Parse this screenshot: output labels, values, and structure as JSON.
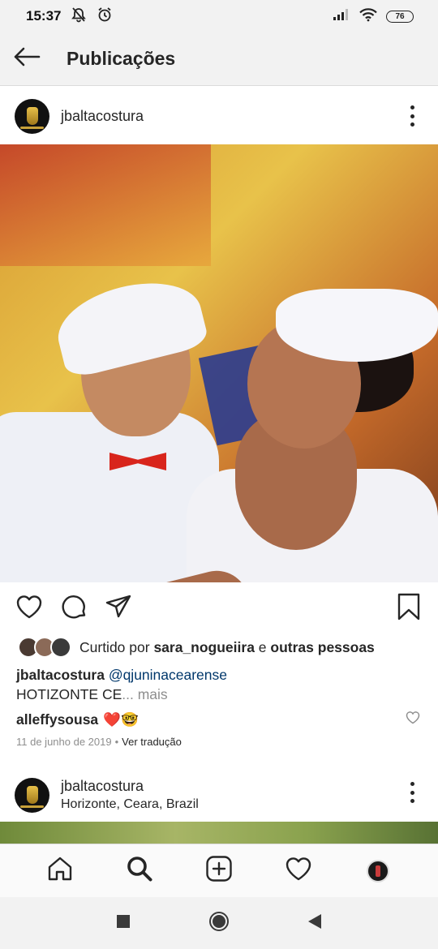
{
  "status_bar": {
    "time": "15:37",
    "battery": "76",
    "icons": [
      "mute-notifications-icon",
      "alarm-icon",
      "signal-icon",
      "wifi-icon",
      "battery-icon"
    ]
  },
  "header": {
    "title": "Publicações",
    "back_icon": "arrow-left-icon"
  },
  "post": {
    "username": "jbaltacostura",
    "actions": [
      "heart-icon",
      "comment-icon",
      "share-icon",
      "bookmark-icon"
    ],
    "likes": {
      "prefix": "Curtido por ",
      "user": "sara_nogueiira",
      "connector": " e ",
      "others": "outras pessoas"
    },
    "caption": {
      "user": "jbaltacostura",
      "mention": "@qjuninacearense",
      "text": "HOTIZONTE CE",
      "more": "... mais"
    },
    "comment": {
      "user": "alleffysousa",
      "emojis": "❤️🤓"
    },
    "date": "11 de junho de 2019",
    "translate": "Ver tradução"
  },
  "post2": {
    "username": "jbaltacostura",
    "location": "Horizonte, Ceara, Brazil"
  },
  "bottom_nav": [
    "home-icon",
    "search-icon",
    "new-post-icon",
    "activity-heart-icon",
    "profile-avatar"
  ],
  "system_nav": [
    "recents-square-icon",
    "home-circle-icon",
    "back-triangle-icon"
  ],
  "colors": {
    "text": "#262626",
    "secondary": "#8e8e8e",
    "mention": "#00376b",
    "divider": "#dbdbdb",
    "bar_background": "#f2f2f2"
  }
}
